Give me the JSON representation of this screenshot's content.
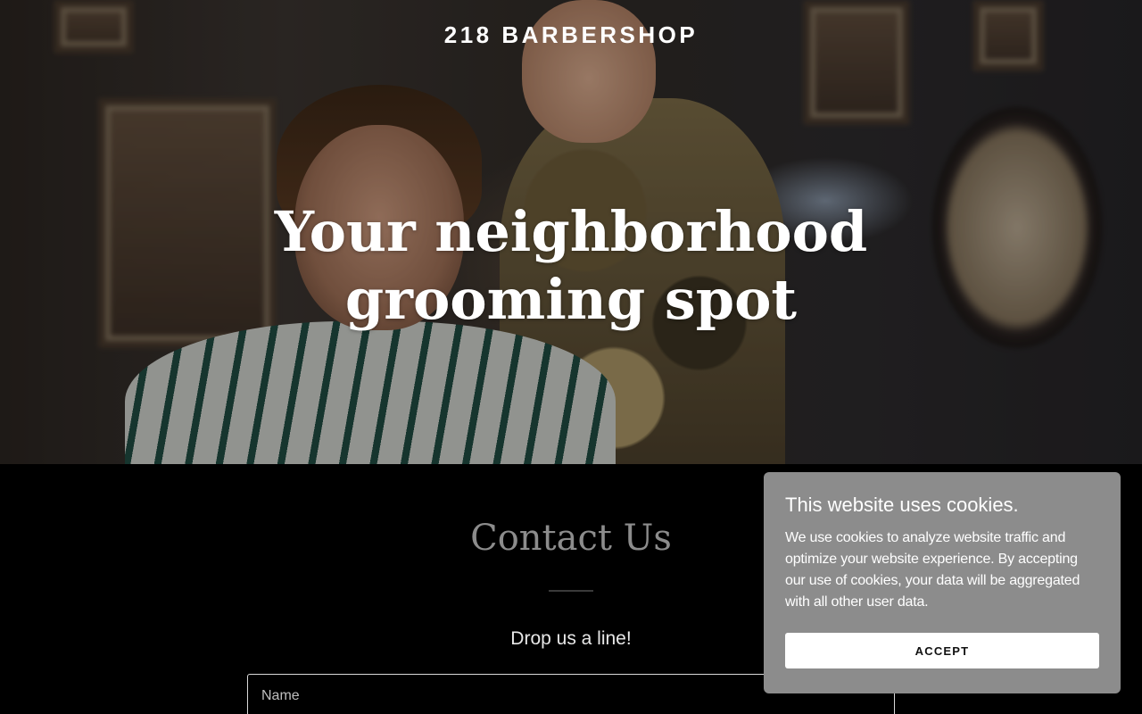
{
  "hero": {
    "brand": "218 BARBERSHOP",
    "headline_line1": "Your neighborhood",
    "headline_line2": "grooming spot"
  },
  "contact": {
    "title": "Contact Us",
    "subtitle": "Drop us a line!",
    "name_placeholder": "Name"
  },
  "cookie_banner": {
    "title": "This website uses cookies.",
    "body": "We use cookies to analyze website traffic and optimize your website experience. By accepting our use of cookies, your data will be aggregated with all other user data.",
    "accept_label": "ACCEPT"
  }
}
